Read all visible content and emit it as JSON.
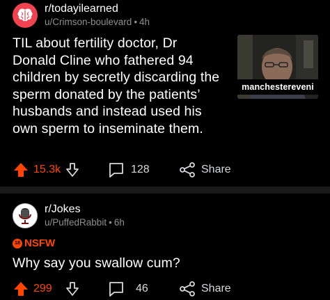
{
  "colors": {
    "upvote": "#ff4500",
    "til_icon_bg": "#f0434f",
    "divider": "#1a1a1b",
    "meta_gray": "#8b8f94"
  },
  "posts": [
    {
      "subreddit": "r/todayilearned",
      "author": "u/Crimson-boulevard",
      "age": "4h",
      "title": "TIL about fertility doctor, Dr Donald Cline who fathered 94 children by secretly discarding the sperm donated by the patients’ husbands and instead used his own sperm to inseminate them.",
      "thumbnail_caption": "manchestereveni",
      "votes": "15.3k",
      "comments": "128",
      "share_label": "Share",
      "icons": {
        "subreddit": "brain-icon",
        "up": "upvote-arrow-icon",
        "down": "downvote-arrow-icon",
        "comments": "comment-bubble-icon",
        "share": "share-icon"
      }
    },
    {
      "subreddit": "r/Jokes",
      "author": "u/PuffedRabbit",
      "age": "6h",
      "nsfw_label": "NSFW",
      "nsfw_badge": "18",
      "title": "Why say you swallow cum?",
      "votes": "299",
      "comments": "46",
      "share_label": "Share",
      "icons": {
        "subreddit": "microphone-icon",
        "up": "upvote-arrow-icon",
        "down": "downvote-arrow-icon",
        "comments": "comment-bubble-icon",
        "share": "share-icon"
      }
    }
  ]
}
